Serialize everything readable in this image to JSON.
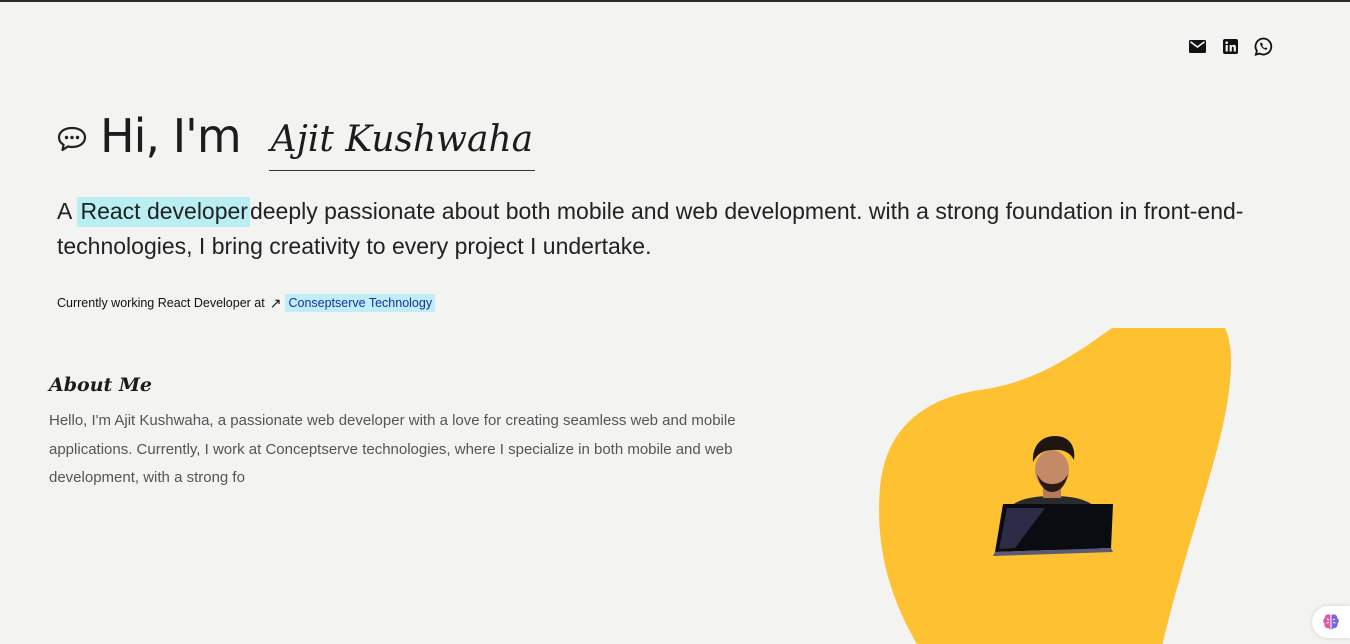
{
  "social": {
    "icons": [
      "mail-icon",
      "linkedin-icon",
      "whatsapp-icon"
    ]
  },
  "hero": {
    "greeting": "Hi, I'm",
    "name": "Ajit Kushwaha"
  },
  "intro": {
    "prefix": "A",
    "highlight": "React developer",
    "rest": "deeply passionate about both mobile and web development. with a strong foundation in front-end-technologies, I bring creativity to every project I undertake."
  },
  "current": {
    "text": "Currently working React Developer at",
    "arrow": "↗",
    "company": "Conseptserve Technology"
  },
  "about": {
    "heading": "About Me",
    "text": "Hello, I'm Ajit Kushwaha, a passionate web developer with a love for creating seamless web and mobile applications. Currently, I work at Conceptserve technologies, where I specialize in both mobile and web development, with a strong fo"
  },
  "colors": {
    "highlight": "#b9eef2",
    "blob": "#fdc132",
    "background": "#f3f3f2"
  }
}
